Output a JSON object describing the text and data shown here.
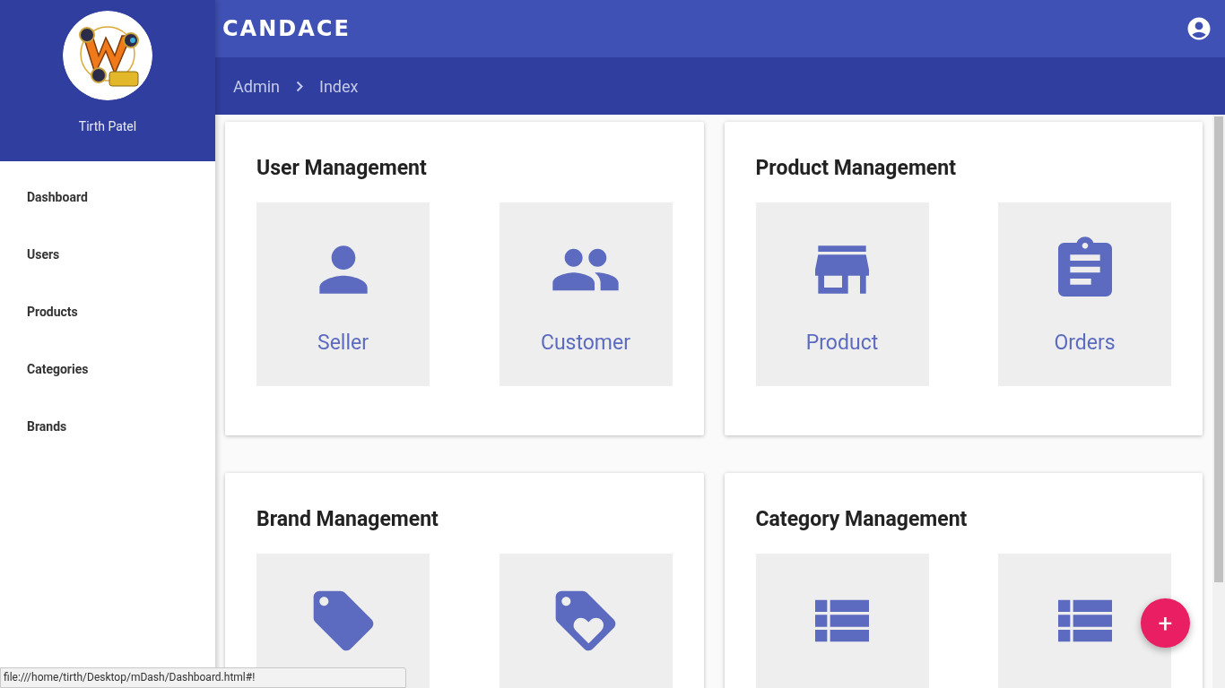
{
  "header": {
    "logo": "CANDACE"
  },
  "breadcrumb": [
    "Admin",
    "Index"
  ],
  "profile": {
    "name": "Tirth Patel"
  },
  "sidebar": {
    "items": [
      "Dashboard",
      "Users",
      "Products",
      "Categories",
      "Brands"
    ]
  },
  "sections": [
    {
      "title": "User Management",
      "tiles": [
        "Seller",
        "Customer"
      ]
    },
    {
      "title": "Product Management",
      "tiles": [
        "Product",
        "Orders"
      ]
    },
    {
      "title": "Brand Management"
    },
    {
      "title": "Category Management"
    }
  ],
  "fab": {
    "label": "+"
  },
  "status_bar": {
    "url": "file:///home/tirth/Desktop/mDash/Dashboard.html#!"
  }
}
